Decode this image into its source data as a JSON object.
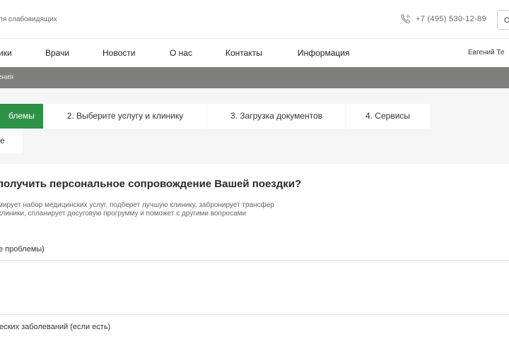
{
  "header": {
    "vision_link": "ля слабовидящих",
    "phone": "+7 (495) 530-12-89",
    "button_label": "О",
    "phone_icon": "phone-icon"
  },
  "nav": {
    "items": [
      {
        "label": "ики"
      },
      {
        "label": "Врачи"
      },
      {
        "label": "Новости"
      },
      {
        "label": "О нас"
      },
      {
        "label": "Контакты"
      },
      {
        "label": "Информация"
      }
    ],
    "user": "Евгений Те"
  },
  "breadcrumb": "ения",
  "steps": [
    {
      "label": "блемы",
      "active": true
    },
    {
      "label": "2. Выберите услугу и клинику",
      "active": false
    },
    {
      "label": "3. Загрузка документов",
      "active": false
    },
    {
      "label": "4. Сервисы",
      "active": false
    }
  ],
  "sub_tab": "е",
  "form": {
    "title": "получить персональное сопровождение Вашей поездки?",
    "description": [
      "мирует набор медицинских услуг, подберет лучшую клинику, забронирует трансфер",
      "клиники, спланирует досуговую прогрумму и поможет с другими вопросами"
    ],
    "field1_label": "е проблемы)",
    "field2_label": "еских заболеваний (если есть)"
  },
  "colors": {
    "accent": "#2e9148",
    "breadcrumb_bg": "#7e807e",
    "page_bg": "#f4f5f4"
  }
}
